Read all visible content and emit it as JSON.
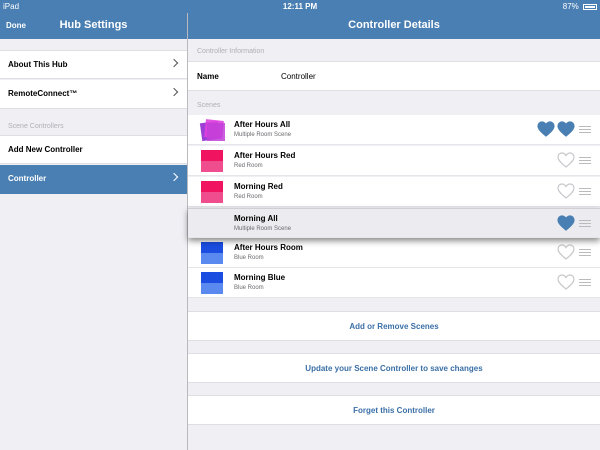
{
  "status": {
    "device": "iPad",
    "time": "12:11 PM",
    "battery": "87%"
  },
  "left_nav": {
    "done": "Done",
    "title": "Hub Settings"
  },
  "right_nav": {
    "title": "Controller Details"
  },
  "sidebar": {
    "items": [
      {
        "label": "About This Hub"
      },
      {
        "label": "RemoteConnect™"
      }
    ],
    "section_header": "Scene Controllers",
    "controllers": [
      {
        "label": "Add New Controller"
      },
      {
        "label": "Controller",
        "selected": true
      }
    ]
  },
  "details": {
    "info_header": "Controller Information",
    "name_key": "Name",
    "name_value": "Controller",
    "scenes_header": "Scenes",
    "scenes": [
      {
        "name": "After Hours All",
        "room": "Multiple Room Scene",
        "favorites": 2,
        "colors": [
          "#9b3fd6",
          "#e040e0",
          "#c23fd8"
        ]
      },
      {
        "name": "After Hours Red",
        "room": "Red Room",
        "favorites": 0,
        "colors": [
          "#f0135f",
          "#f04d8f"
        ]
      },
      {
        "name": "Morning Red",
        "room": "Red Room",
        "favorites": 0,
        "colors": [
          "#f0135f",
          "#f04d8f"
        ]
      },
      {
        "name": "Morning All",
        "room": "Multiple Room Scene",
        "favorites": 1,
        "dragging": true
      },
      {
        "name": "After Hours Room",
        "room": "Blue Room",
        "favorites": 0,
        "colors": [
          "#1a4de0",
          "#5a8af0"
        ]
      },
      {
        "name": "Morning Blue",
        "room": "Blue Room",
        "favorites": 0,
        "colors": [
          "#1a4de0",
          "#5a8af0"
        ]
      }
    ],
    "add_remove": "Add or Remove Scenes",
    "update": "Update your Scene Controller to save changes",
    "forget": "Forget this Controller"
  },
  "colors": {
    "accent": "#4a7fb3",
    "link": "#3a6fa6",
    "heart_filled": "#4a7fb3",
    "heart_empty": "#c8c8cc"
  }
}
